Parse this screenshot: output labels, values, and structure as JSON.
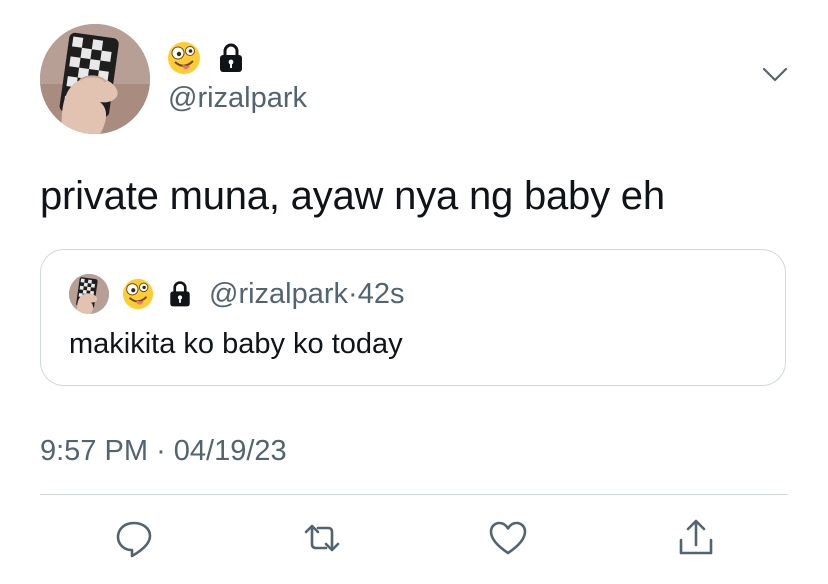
{
  "tweet": {
    "handle": "@rizalpark",
    "text": "private muna, ayaw nya ng baby eh",
    "timestamp": "9:57 PM",
    "date": "04/19/23",
    "separator": "·"
  },
  "quoted": {
    "handle": "@rizalpark",
    "separator": "·",
    "age": "42s",
    "text": "makikita ko baby ko today"
  },
  "icons": {
    "name_emoji": "zany-face-emoji",
    "protected": "lock-icon",
    "more": "chevron-down-icon",
    "reply": "reply-icon",
    "retweet": "retweet-icon",
    "like": "heart-icon",
    "share": "share-icon"
  },
  "colors": {
    "text": "#0f1419",
    "secondary": "#536471",
    "border": "#cfd9de"
  }
}
